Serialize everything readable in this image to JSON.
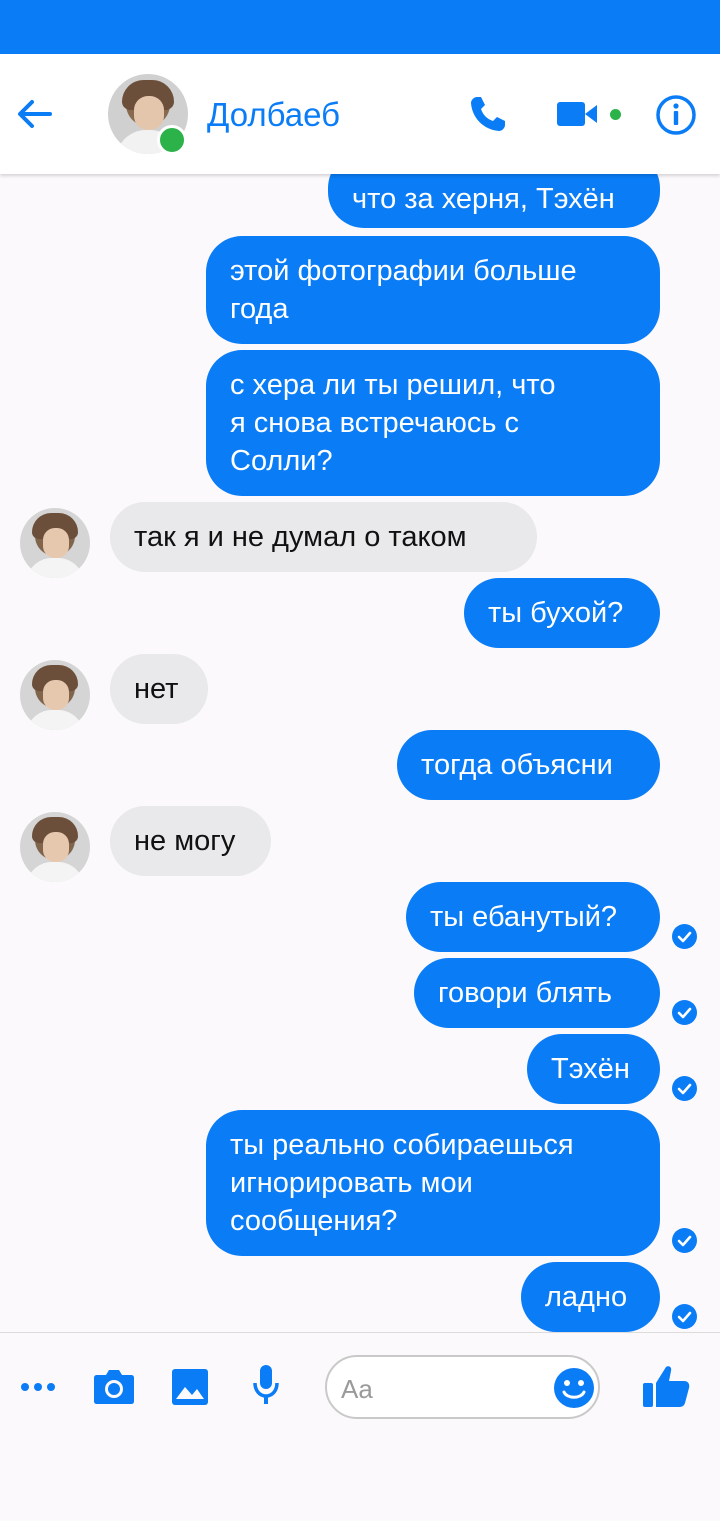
{
  "header": {
    "contact_name": "Долбаеб",
    "icons": [
      "back-arrow-icon",
      "phone-icon",
      "video-camera-icon",
      "info-icon"
    ]
  },
  "messages": [
    {
      "dir": "out",
      "text": "что за херня, Тэхён"
    },
    {
      "dir": "out",
      "text": "этой фотографии больше\nгода"
    },
    {
      "dir": "out",
      "text": "с хера ли ты решил, что\nя снова встречаюсь с\nСолли?"
    },
    {
      "dir": "in",
      "text": "так я и не думал о таком"
    },
    {
      "dir": "out",
      "text": "ты бухой?"
    },
    {
      "dir": "in",
      "text": "нет"
    },
    {
      "dir": "out",
      "text": "тогда объясни"
    },
    {
      "dir": "in",
      "text": "не могу"
    },
    {
      "dir": "out",
      "text": "ты ебанутый?",
      "seen": true
    },
    {
      "dir": "out",
      "text": "говори блять",
      "seen": true
    },
    {
      "dir": "out",
      "text": "Тэхён",
      "seen": true
    },
    {
      "dir": "out",
      "text": "ты реально собираешься\nигнорировать мои\nсообщения?",
      "seen": true
    },
    {
      "dir": "out",
      "text": "ладно",
      "seen": true
    }
  ],
  "composer": {
    "placeholder": "Aa",
    "icons": [
      "more-dots-icon",
      "camera-icon",
      "gallery-icon",
      "microphone-icon",
      "emoji-icon",
      "thumbs-up-icon"
    ]
  },
  "colors": {
    "accent": "#0a7cf6",
    "incoming": "#e9e8ea",
    "online": "#2bb34a"
  }
}
